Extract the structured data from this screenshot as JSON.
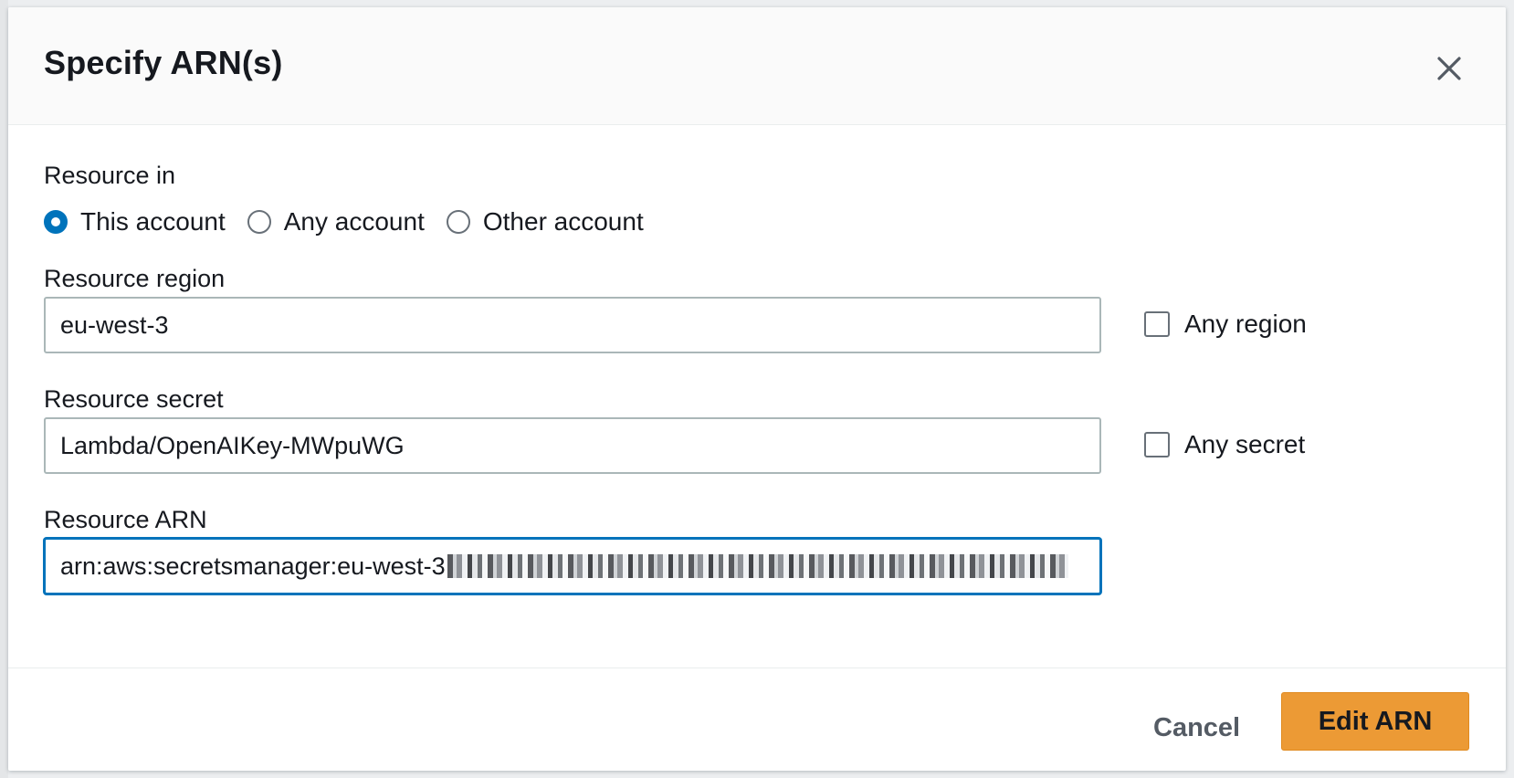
{
  "modal": {
    "title": "Specify ARN(s)"
  },
  "resource_in": {
    "label": "Resource in",
    "options": [
      {
        "label": "This account",
        "selected": true
      },
      {
        "label": "Any account",
        "selected": false
      },
      {
        "label": "Other account",
        "selected": false
      }
    ]
  },
  "region": {
    "label": "Resource region",
    "value": "eu-west-3",
    "any_label": "Any region",
    "any_checked": false
  },
  "secret": {
    "label": "Resource secret",
    "value": "Lambda/OpenAIKey-MWpuWG",
    "any_label": "Any secret",
    "any_checked": false
  },
  "arn": {
    "label": "Resource ARN",
    "value_visible": "arn:aws:secretsmanager:eu-west-3"
  },
  "footer": {
    "cancel_label": "Cancel",
    "primary_label": "Edit ARN"
  },
  "colors": {
    "primary": "#ec9a35",
    "focus": "#0073bb",
    "radio_selected": "#0073bb"
  },
  "icons": {
    "close": "close-icon"
  }
}
